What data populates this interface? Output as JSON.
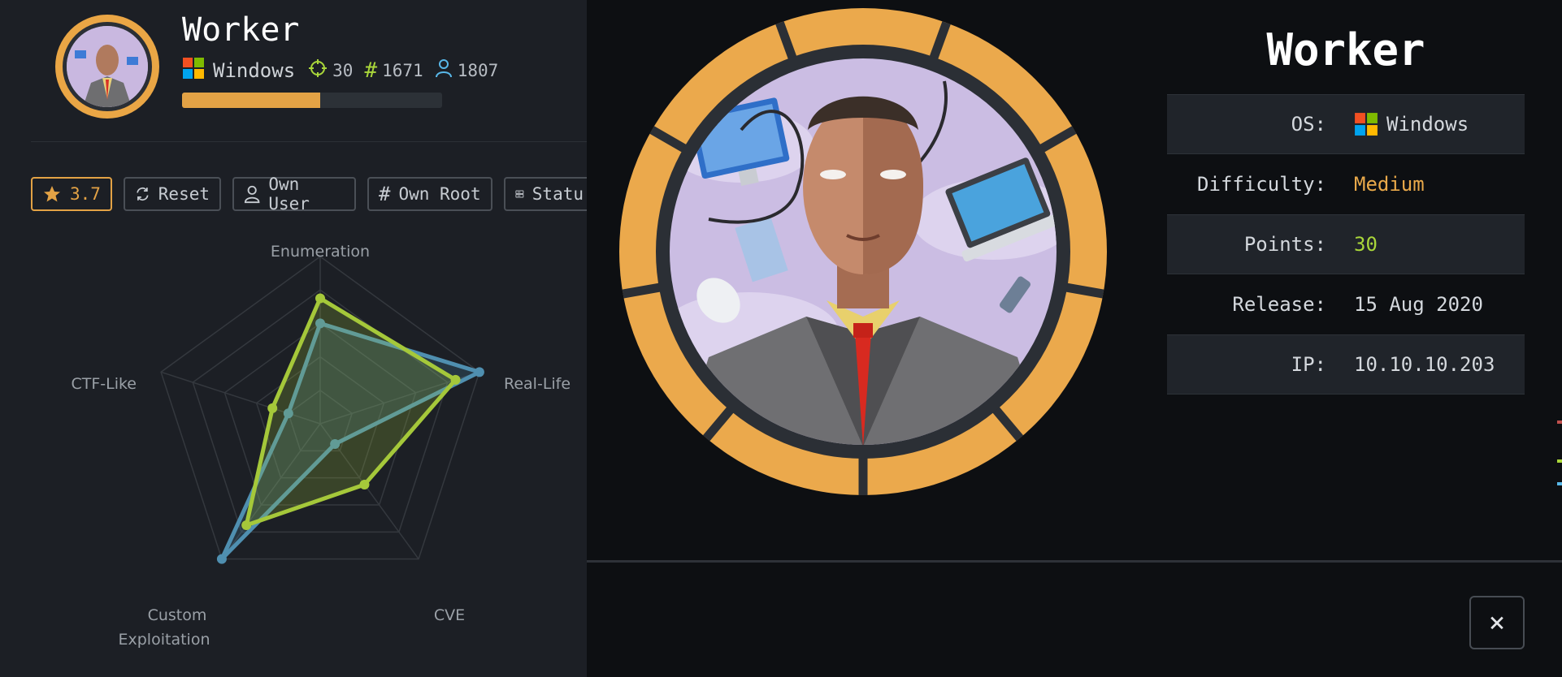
{
  "machine": {
    "name": "Worker",
    "os": "Windows",
    "points": "30",
    "rank": "1671",
    "users": "1807",
    "progress_fraction": 0.53
  },
  "toolbar": {
    "rating": "3.7",
    "reset_label": "Reset",
    "own_user_label": "Own User",
    "own_root_label": "Own Root",
    "status_label": "Statu"
  },
  "radar": {
    "axes": [
      "Enumeration",
      "Real-Life",
      "CVE",
      "Custom Exploitation",
      "CTF-Like"
    ],
    "axis_label_lines": {
      "enumeration": "Enumeration",
      "real_life": "Real-Life",
      "cve": "CVE",
      "custom_1": "Custom",
      "custom_2": "Exploitation",
      "ctf": "CTF-Like"
    },
    "series": [
      {
        "color": "#4f8fb0",
        "values": [
          0.6,
          1.0,
          0.15,
          1.0,
          0.2
        ]
      },
      {
        "color": "#a5c83a",
        "values": [
          0.75,
          0.85,
          0.45,
          0.75,
          0.3
        ]
      }
    ]
  },
  "info": {
    "title": "Worker",
    "rows": [
      {
        "key": "OS:",
        "value": "Windows"
      },
      {
        "key": "Difficulty:",
        "value": "Medium"
      },
      {
        "key": "Points:",
        "value": "30"
      },
      {
        "key": "Release:",
        "value": "15 Aug 2020"
      },
      {
        "key": "IP:",
        "value": "10.10.10.203"
      }
    ]
  },
  "modal": {
    "close_label": "×"
  },
  "colors": {
    "accent_orange": "#e3a245",
    "accent_green": "#a9d63a",
    "background": "#0d0f12"
  }
}
